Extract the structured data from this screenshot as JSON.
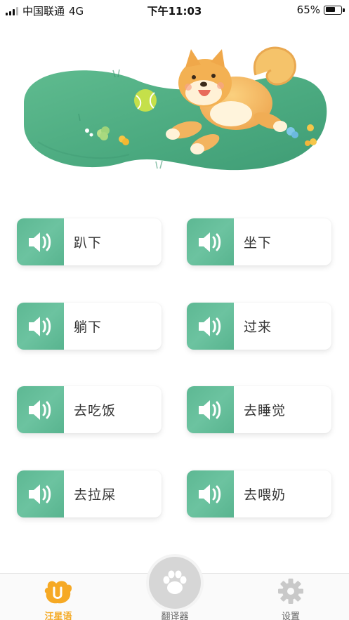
{
  "status_bar": {
    "carrier": "中国联通",
    "network": "4G",
    "time": "下午11:03",
    "battery_text": "65%",
    "battery_level": 0.65
  },
  "hero": {
    "image": "shiba-dog-playing-with-ball-on-grass"
  },
  "commands": [
    {
      "label": "趴下",
      "icon": "speaker-icon"
    },
    {
      "label": "坐下",
      "icon": "speaker-icon"
    },
    {
      "label": "躺下",
      "icon": "speaker-icon"
    },
    {
      "label": "过来",
      "icon": "speaker-icon"
    },
    {
      "label": "去吃饭",
      "icon": "speaker-icon"
    },
    {
      "label": "去睡觉",
      "icon": "speaker-icon"
    },
    {
      "label": "去拉屎",
      "icon": "speaker-icon"
    },
    {
      "label": "去喂奶",
      "icon": "speaker-icon"
    }
  ],
  "tabbar": {
    "home": {
      "label": "汪星语",
      "icon": "dog-head-icon",
      "active": true
    },
    "translator": {
      "label": "翻译器",
      "icon": "paw-icon"
    },
    "settings": {
      "label": "设置",
      "icon": "gear-icon"
    }
  },
  "colors": {
    "accent_green": "#5db893",
    "active_tab": "#f4a820",
    "grass": "#4fae84"
  }
}
